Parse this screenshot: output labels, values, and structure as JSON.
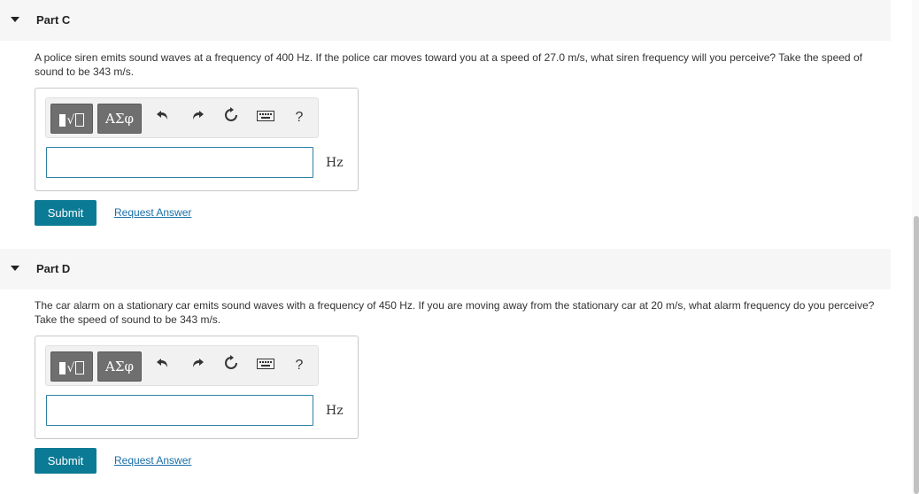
{
  "parts": [
    {
      "title": "Part C",
      "question": "A police siren emits sound waves at a frequency of 400 Hz. If the police car moves toward you at a speed of 27.0 m/s, what siren frequency will you perceive? Take the speed of sound to be 343 m/s.",
      "greek_label": "ΑΣφ",
      "unit": "Hz",
      "answer_value": "",
      "submit_label": "Submit",
      "request_label": "Request Answer"
    },
    {
      "title": "Part D",
      "question": "The car alarm on a stationary car emits sound waves with a frequency of 450 Hz. If you are moving away from the stationary car at 20 m/s, what alarm frequency do you perceive? Take the speed of sound to be 343 m/s.",
      "greek_label": "ΑΣφ",
      "unit": "Hz",
      "answer_value": "",
      "submit_label": "Submit",
      "request_label": "Request Answer"
    }
  ],
  "toolbar": {
    "help_label": "?",
    "icons": [
      "templates-icon",
      "greek-symbols-icon",
      "undo-icon",
      "redo-icon",
      "reset-icon",
      "keyboard-icon",
      "help-icon"
    ]
  }
}
